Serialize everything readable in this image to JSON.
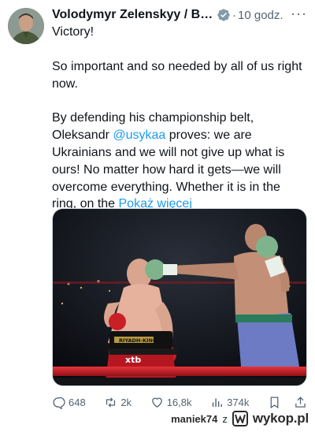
{
  "tweet": {
    "author_name": "Volodymyr Zelenskyy / Bo...",
    "separator": "·",
    "time": "10 godz.",
    "more_label": "···",
    "paragraphs": {
      "p1": "Victory!",
      "p2": "So important and so needed by all of us right now.",
      "p3_before": "By defending his championship belt, Oleksandr ",
      "p3_mention": "@usykaa",
      "p3_after": " proves: we are Ukrainians and we will not give up what is ours! No matter how hard it gets—we will overcome everything. Whether it is in the ring, on the ",
      "show_more": "Pokaż więcej"
    },
    "media": {
      "banner_left": "RIYADH-KING",
      "shorts_logo": "xtb"
    }
  },
  "actions": {
    "replies": "648",
    "reposts": "2k",
    "likes": "16,8k",
    "views": "374k"
  },
  "watermark": {
    "user": "maniek74",
    "preposition": "z",
    "brand": "wykop.pl"
  },
  "colors": {
    "link": "#1d9bf0",
    "muted": "#536471",
    "text": "#0f1419"
  }
}
